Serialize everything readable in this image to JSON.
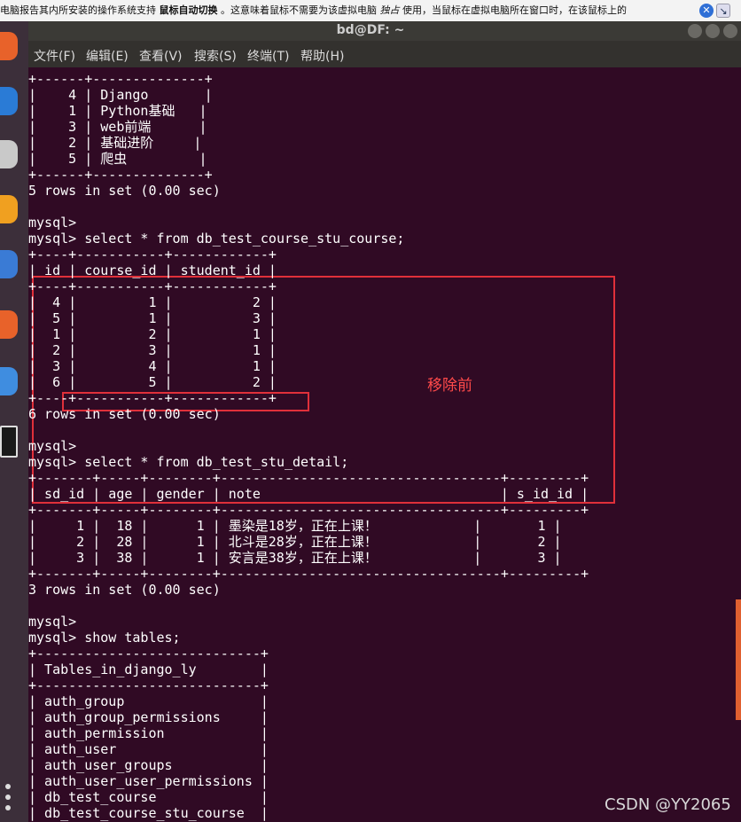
{
  "banner": {
    "text_a": "电脑报告其内所安装的操作系统支持",
    "bold": "鼠标自动切换",
    "text_b": "。这意味着鼠标不需要为该虚拟电脑",
    "exclusive": "独占",
    "text_c": "使用，当鼠标在虚拟电脑所在窗口时，在该鼠标上的"
  },
  "window": {
    "title": "bd@DF: ~"
  },
  "menu": [
    "文件(F)",
    "编辑(E)",
    "查看(V)",
    "搜索(S)",
    "终端(T)",
    "帮助(H)"
  ],
  "annotation": "移除前",
  "watermark": "CSDN @YY2065",
  "terminal_lines": [
    "+------+--------------+",
    "|    4 | Django       |",
    "|    1 | Python基础   |",
    "|    3 | web前端      |",
    "|    2 | 基础进阶     |",
    "|    5 | 爬虫         |",
    "+------+--------------+",
    "5 rows in set (0.00 sec)",
    "",
    "mysql>",
    "mysql> select * from db_test_course_stu_course;",
    "+----+-----------+------------+",
    "| id | course_id | student_id |",
    "+----+-----------+------------+",
    "|  4 |         1 |          2 |",
    "|  5 |         1 |          3 |",
    "|  1 |         2 |          1 |",
    "|  2 |         3 |          1 |",
    "|  3 |         4 |          1 |",
    "|  6 |         5 |          2 |",
    "+----+-----------+------------+",
    "6 rows in set (0.00 sec)",
    "",
    "mysql>",
    "mysql> select * from db_test_stu_detail;",
    "+-------+-----+--------+-----------------------------------+---------+",
    "| sd_id | age | gender | note                              | s_id_id |",
    "+-------+-----+--------+-----------------------------------+---------+",
    "|     1 |  18 |      1 | 墨染是18岁，正在上课！            |       1 |",
    "|     2 |  28 |      1 | 北斗是28岁，正在上课！            |       2 |",
    "|     3 |  38 |      1 | 安言是38岁，正在上课！            |       3 |",
    "+-------+-----+--------+-----------------------------------+---------+",
    "3 rows in set (0.00 sec)",
    "",
    "mysql>",
    "mysql> show tables;",
    "+----------------------------+",
    "| Tables_in_django_ly        |",
    "+----------------------------+",
    "| auth_group                 |",
    "| auth_group_permissions     |",
    "| auth_permission            |",
    "| auth_user                  |",
    "| auth_user_groups           |",
    "| auth_user_user_permissions |",
    "| db_test_course             |",
    "| db_test_course_stu_course  |"
  ],
  "colors": {
    "terminal_bg": "#300a24",
    "highlight": "#e0303a"
  }
}
